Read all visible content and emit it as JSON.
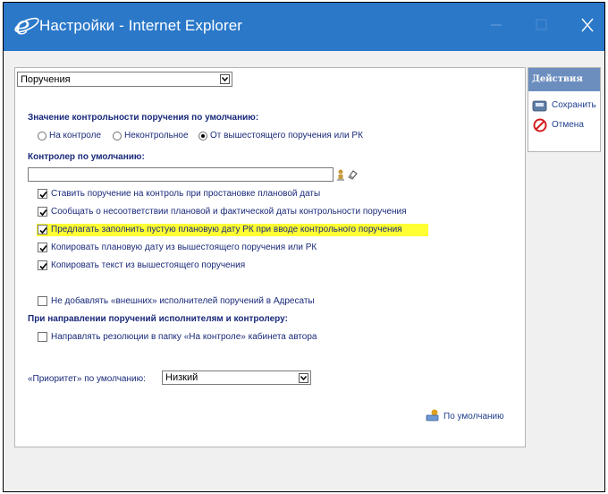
{
  "window": {
    "title": "Настройки - Internet Explorer"
  },
  "main": {
    "mode_select": {
      "value": "Поручения"
    },
    "control_default": {
      "heading": "Значение контрольности поручения по умолчанию:",
      "options": [
        {
          "label": "На контроле",
          "selected": false
        },
        {
          "label": "Неконтрольное",
          "selected": false
        },
        {
          "label": "От вышестоящего поручения или РК",
          "selected": true
        }
      ]
    },
    "controller": {
      "heading": "Контролер по умолчанию:",
      "value": ""
    },
    "checkboxes": [
      {
        "label": "Ставить поручение на контроль при простановке плановой даты",
        "checked": true
      },
      {
        "label": "Сообщать о несоответствии плановой и фактической даты контрольности поручения",
        "checked": true
      },
      {
        "label": "Предлагать заполнить пустую плановую дату РК при вводе контрольного поручения",
        "checked": true,
        "highlighted": true
      },
      {
        "label": "Копировать плановую дату из вышестоящего поручения или РК",
        "checked": true
      },
      {
        "label": "Копировать текст из вышестоящего поручения",
        "checked": true
      }
    ],
    "external_executors": {
      "label": "Не добавлять «внешних» исполнителей поручений в Адресаты",
      "checked": false
    },
    "sending": {
      "heading": "При направлении поручений исполнителям и контролеру:",
      "checkbox": {
        "label": "Направлять резолюции в папку «На контроле» кабинета автора",
        "checked": false
      }
    },
    "priority": {
      "label": "«Приоритет» по умолчанию:",
      "value": "Низкий"
    },
    "defaults_link": "По умолчанию"
  },
  "actions": {
    "header": "Действия",
    "save": "Сохранить",
    "cancel": "Отмена"
  },
  "colors": {
    "titlebar": "#2b78c9",
    "actions_header": "#6c8ebf",
    "label_text": "#1a2a7a",
    "highlight": "#ffff33"
  }
}
